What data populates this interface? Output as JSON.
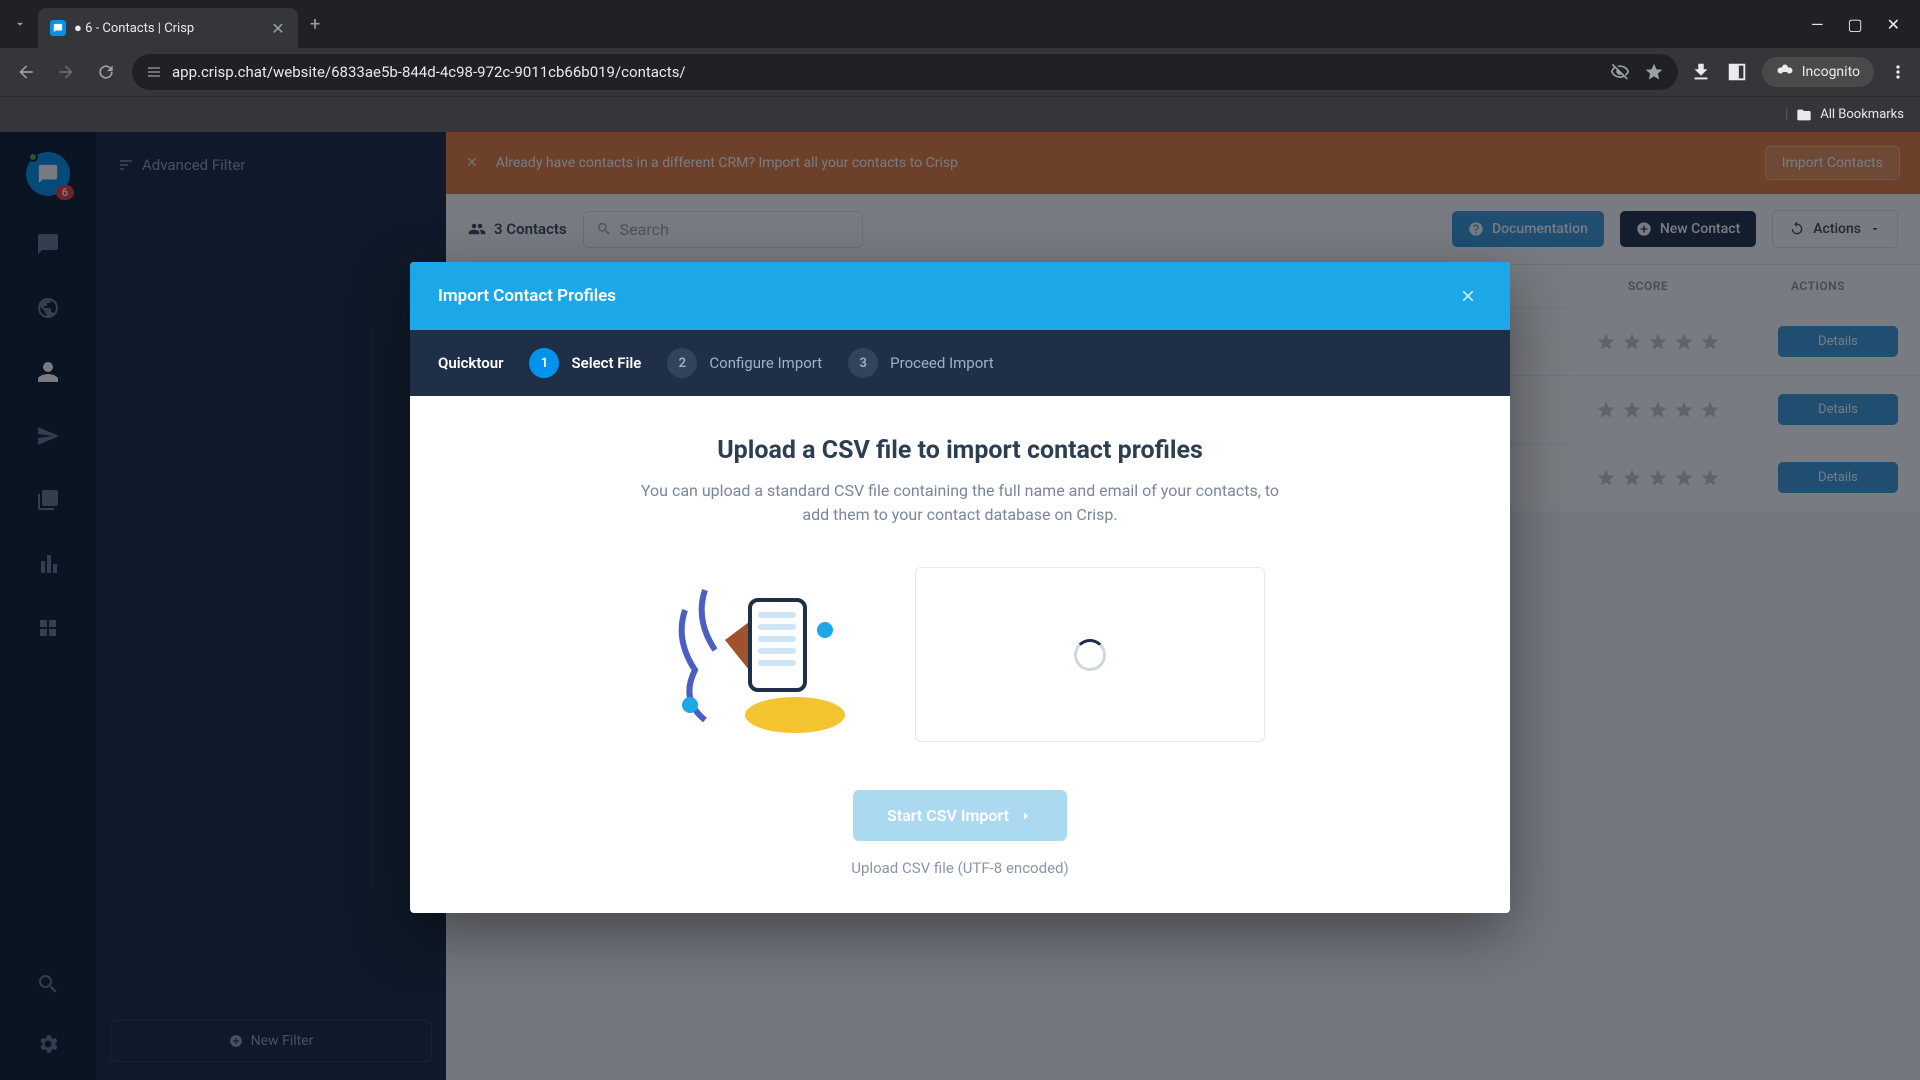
{
  "browser": {
    "tab_title": "● 6 - Contacts | Crisp",
    "url": "app.crisp.chat/website/6833ae5b-844d-4c98-972c-9011cb66b019/contacts/",
    "incognito": "Incognito",
    "bookmarks": "All Bookmarks"
  },
  "rail": {
    "badge": "6"
  },
  "sidebar": {
    "advanced_filter": "Advanced Filter",
    "new_filter": "New Filter"
  },
  "banner": {
    "text": "Already have contacts in a different CRM? Import all your contacts to Crisp",
    "button": "Import Contacts"
  },
  "toolbar": {
    "count": "3 Contacts",
    "search_placeholder": "Search",
    "documentation": "Documentation",
    "new_contact": "New Contact",
    "actions": "Actions"
  },
  "table": {
    "col_score": "SCORE",
    "col_actions": "ACTIONS",
    "row_button": "Details"
  },
  "modal": {
    "title": "Import Contact Profiles",
    "quicktour": "Quicktour",
    "steps": [
      {
        "num": "1",
        "label": "Select File"
      },
      {
        "num": "2",
        "label": "Configure Import"
      },
      {
        "num": "3",
        "label": "Proceed Import"
      }
    ],
    "heading": "Upload a CSV file to import contact profiles",
    "description": "You can upload a standard CSV file containing the full name and email of your contacts, to add them to your contact database on Crisp.",
    "start_button": "Start CSV Import",
    "note": "Upload CSV file (UTF-8 encoded)"
  }
}
